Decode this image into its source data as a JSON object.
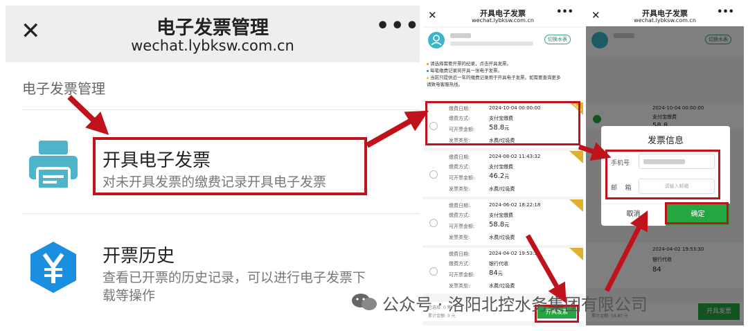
{
  "panel1": {
    "title": "电子发票管理",
    "url": "wechat.lybksw.com.cn",
    "section_title": "电子发票管理",
    "items": [
      {
        "title": "开具电子发票",
        "desc": "对未开具发票的缴费记录开具电子发票",
        "icon": "printer-icon"
      },
      {
        "title": "开票历史",
        "desc_line1": "查看已开票的历史记录，可以进行电子发票下",
        "desc_line2": "载等操作",
        "icon": "yen-icon"
      }
    ]
  },
  "panel2": {
    "title": "开具电子发票",
    "url": "wechat.lybksw.com.cn",
    "switch_label": "切换水表",
    "notices": [
      "请选择需要开票的纪录，点击开具发票。",
      "每笔缴费记录将开具一张电子发票。",
      "当前只提供近一年的缴费记录用于开具电子发票。如需要查询更多",
      "请致电客服热线。"
    ],
    "labels": {
      "date": "缴费日期:",
      "method": "缴费方式:",
      "amount": "可开票金额:",
      "type": "发票类型:"
    },
    "ribbon_text": "未开具",
    "records": [
      {
        "date": "2024-10-04 00:00:00",
        "method": "支付宝缴费",
        "amount": "58.8",
        "unit": "元",
        "type": "水费/垃圾费"
      },
      {
        "date": "2024-08-02 11:43:32",
        "method": "支付宝缴费",
        "amount": "46.2",
        "unit": "元",
        "type": "水费/垃圾费"
      },
      {
        "date": "2024-06-02 18:22:18",
        "method": "支付宝缴费",
        "amount": "58.8",
        "unit": "元",
        "type": "水费/垃圾费"
      },
      {
        "date": "2024-04-02 19:53:30",
        "method": "银行代收",
        "amount": "84",
        "unit": "元",
        "type": "水费/垃圾费"
      }
    ],
    "footer_count": "已选择: 0 笔",
    "footer_total": "累计金额: 0 元",
    "submit_label": "开具发票"
  },
  "panel3": {
    "title": "开具电子发票",
    "url": "wechat.lybksw.com.cn",
    "switch_label": "切换水表",
    "dialog": {
      "title": "发票信息",
      "phone_label": "手机号",
      "email_label": "邮    箱",
      "email_placeholder": "请输入邮箱",
      "cancel_label": "取消",
      "confirm_label": "确定"
    },
    "records": [
      {
        "date": "2024-10-04 00:00:00",
        "method": "支付宝缴费",
        "amount": "58.8"
      },
      {
        "date": "2024-04-02 19:53:30",
        "method": "银行代收",
        "amount": "84"
      }
    ],
    "footer_total": "累计金额: 58.80 元",
    "submit_label": "开具发票"
  },
  "watermark": "公众号 · 洛阳北控水务集团有限公司",
  "colors": {
    "red": "#c0121a",
    "green": "#24a740",
    "teal": "#3ab6c8",
    "blue": "#1a8fe0",
    "gold": "#e0b02f"
  }
}
